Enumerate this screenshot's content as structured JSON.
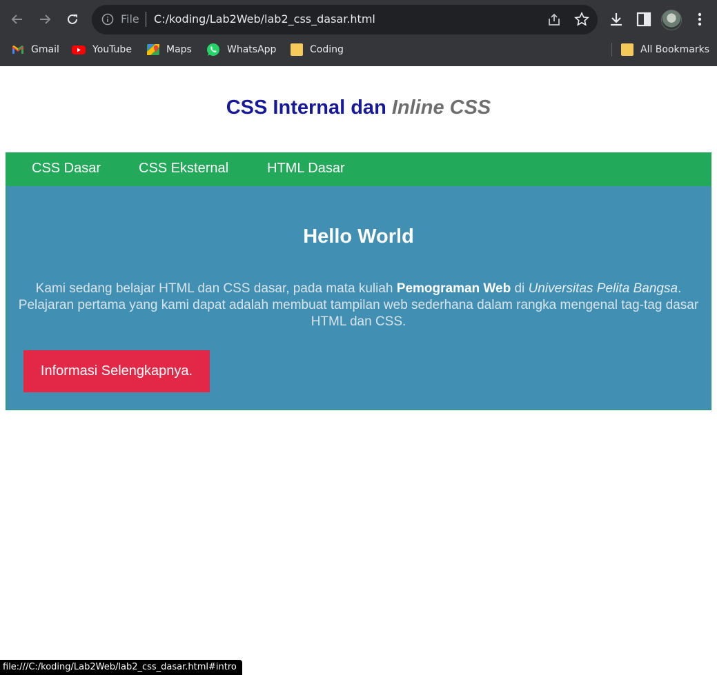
{
  "browser": {
    "address_scheme_label": "File",
    "address_url": "C:/koding/Lab2Web/lab2_css_dasar.html",
    "bookmarks": [
      {
        "label": "Gmail",
        "icon": "gmail-icon"
      },
      {
        "label": "YouTube",
        "icon": "youtube-icon"
      },
      {
        "label": "Maps",
        "icon": "maps-icon"
      },
      {
        "label": "WhatsApp",
        "icon": "whatsapp-icon"
      },
      {
        "label": "Coding",
        "icon": "folder-icon"
      }
    ],
    "all_bookmarks_label": "All Bookmarks",
    "status_url": "file:///C:/koding/Lab2Web/lab2_css_dasar.html#intro"
  },
  "page": {
    "heading_main": "CSS Internal dan ",
    "heading_italic": "Inline CSS",
    "nav": [
      "CSS Dasar",
      "CSS Eksternal",
      "HTML Dasar"
    ],
    "intro": {
      "title": "Hello World",
      "text_before": "Kami sedang belajar HTML dan CSS dasar, pada mata kuliah ",
      "text_bold": "Pemograman Web",
      "text_middle": " di ",
      "text_italic": "Universitas Pelita Bangsa",
      "text_after": ". Pelajaran pertama yang kami dapat adalah membuat tampilan web sederhana dalam rangka mengenal tag-tag dasar HTML dan CSS.",
      "button_label": "Informasi Selengkapnya."
    }
  },
  "colors": {
    "heading": "#161a9a",
    "nav_bg": "#22aa5a",
    "intro_bg": "#4190b3",
    "button_bg": "#e32847"
  }
}
